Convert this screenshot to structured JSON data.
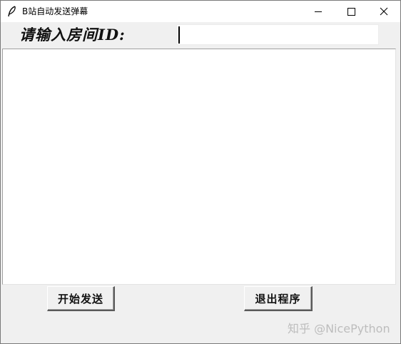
{
  "window": {
    "title": "B站自动发送弹幕",
    "app_icon": "feather-icon",
    "controls": {
      "minimize_icon": "minimize-icon",
      "maximize_icon": "maximize-icon",
      "close_icon": "close-icon"
    }
  },
  "form": {
    "room_label": "请输入房间ID:",
    "room_input_value": ""
  },
  "log": {
    "content": ""
  },
  "buttons": {
    "start_label": "开始发送",
    "exit_label": "退出程序"
  },
  "watermark": "知乎 @NicePython",
  "colors": {
    "titlebar_bg": "#ffffff",
    "window_bg": "#f0f0f0",
    "text_area_bg": "#ffffff",
    "watermark": "#bdbdbd"
  }
}
